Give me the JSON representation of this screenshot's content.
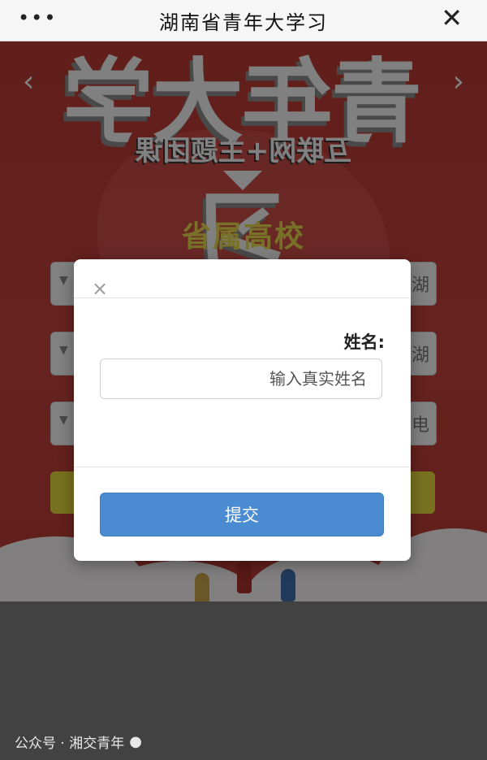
{
  "topbar": {
    "menu_glyph": "•••",
    "title": "湖南省青年大学习",
    "close_glyph": "✕"
  },
  "poster": {
    "big_title": "青年大学习",
    "subtitle": "互联网+主题团课",
    "school": "省属高校",
    "field_edge_1": "湖",
    "field_edge_2": "湖",
    "field_edge_3": "电"
  },
  "modal": {
    "close_glyph": "×",
    "label": "姓名:",
    "input_value": "",
    "input_placeholder": "输入真实姓名",
    "submit_label": "提交"
  },
  "footer": {
    "icon": "wechat-icon",
    "text": "公众号 · 湘交青年"
  },
  "colors": {
    "submit_bg": "#4a8bd2",
    "poster_red": "#c0413a",
    "school_yellow": "#e3d84d"
  }
}
